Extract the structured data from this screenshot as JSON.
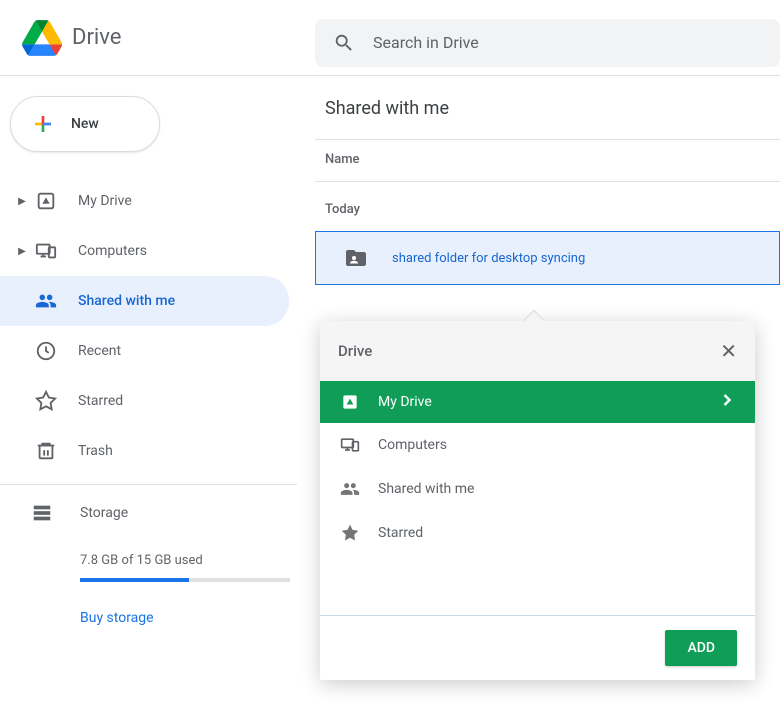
{
  "header": {
    "app_name": "Drive",
    "search_placeholder": "Search in Drive"
  },
  "sidebar": {
    "new_button_label": "New",
    "items": [
      {
        "label": "My Drive"
      },
      {
        "label": "Computers"
      },
      {
        "label": "Shared with me"
      },
      {
        "label": "Recent"
      },
      {
        "label": "Starred"
      },
      {
        "label": "Trash"
      }
    ],
    "storage_label": "Storage",
    "storage_text": "7.8 GB of 15 GB used",
    "storage_fill_percent": 52,
    "buy_label": "Buy storage"
  },
  "main": {
    "title": "Shared with me",
    "column_header": "Name",
    "group_label": "Today",
    "files": [
      {
        "name": "shared folder for desktop syncing"
      }
    ]
  },
  "popup": {
    "title": "Drive",
    "items": [
      {
        "label": "My Drive"
      },
      {
        "label": "Computers"
      },
      {
        "label": "Shared with me"
      },
      {
        "label": "Starred"
      }
    ],
    "add_label": "ADD"
  }
}
